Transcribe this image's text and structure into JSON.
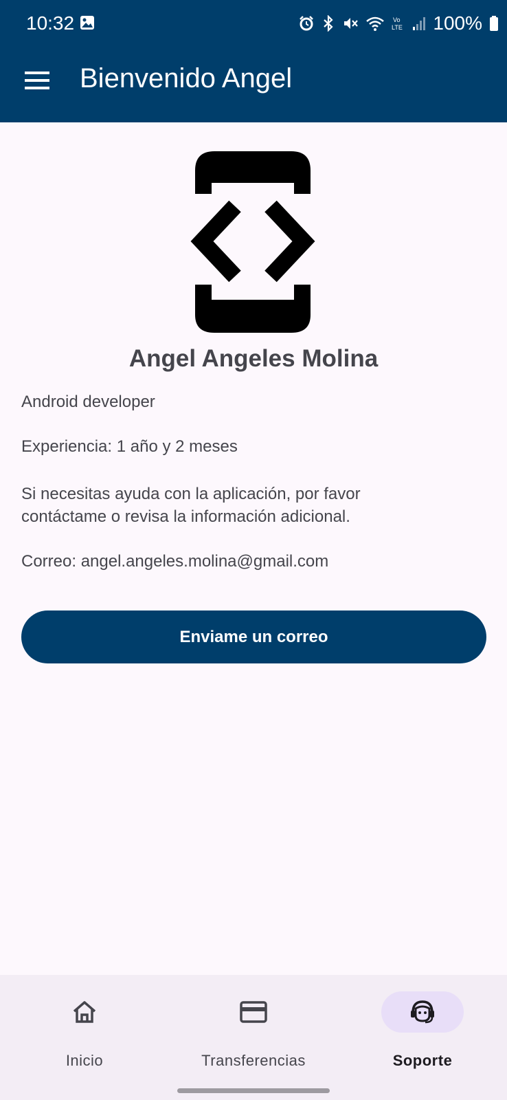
{
  "status_bar": {
    "time": "10:32",
    "battery": "100%",
    "icons": [
      "image-icon",
      "alarm-icon",
      "bluetooth-icon",
      "mute-icon",
      "wifi-icon",
      "volte-icon",
      "signal-icon",
      "battery-icon"
    ]
  },
  "app_bar": {
    "menu_icon": "menu-icon",
    "title": "Bienvenido Angel"
  },
  "profile": {
    "logo_icon": "code-phone-icon",
    "name": "Angel Angeles Molina",
    "role": "Android developer",
    "experience": "Experiencia: 1 año y 2 meses",
    "help_text": "Si necesitas ayuda con la aplicación, por favor contáctame o revisa la información adicional.",
    "email": "Correo: angel.angeles.molina@gmail.com"
  },
  "actions": {
    "send_email_label": "Enviame un correo"
  },
  "bottom_nav": {
    "items": [
      {
        "label": "Inicio",
        "icon": "home-icon",
        "active": false
      },
      {
        "label": "Transferencias",
        "icon": "card-icon",
        "active": false
      },
      {
        "label": "Soporte",
        "icon": "support-agent-icon",
        "active": true
      }
    ]
  },
  "colors": {
    "primary": "#003e6b",
    "background": "#fdf8fd",
    "nav_background": "#f3edf5",
    "nav_active_indicator": "#e8def8"
  }
}
